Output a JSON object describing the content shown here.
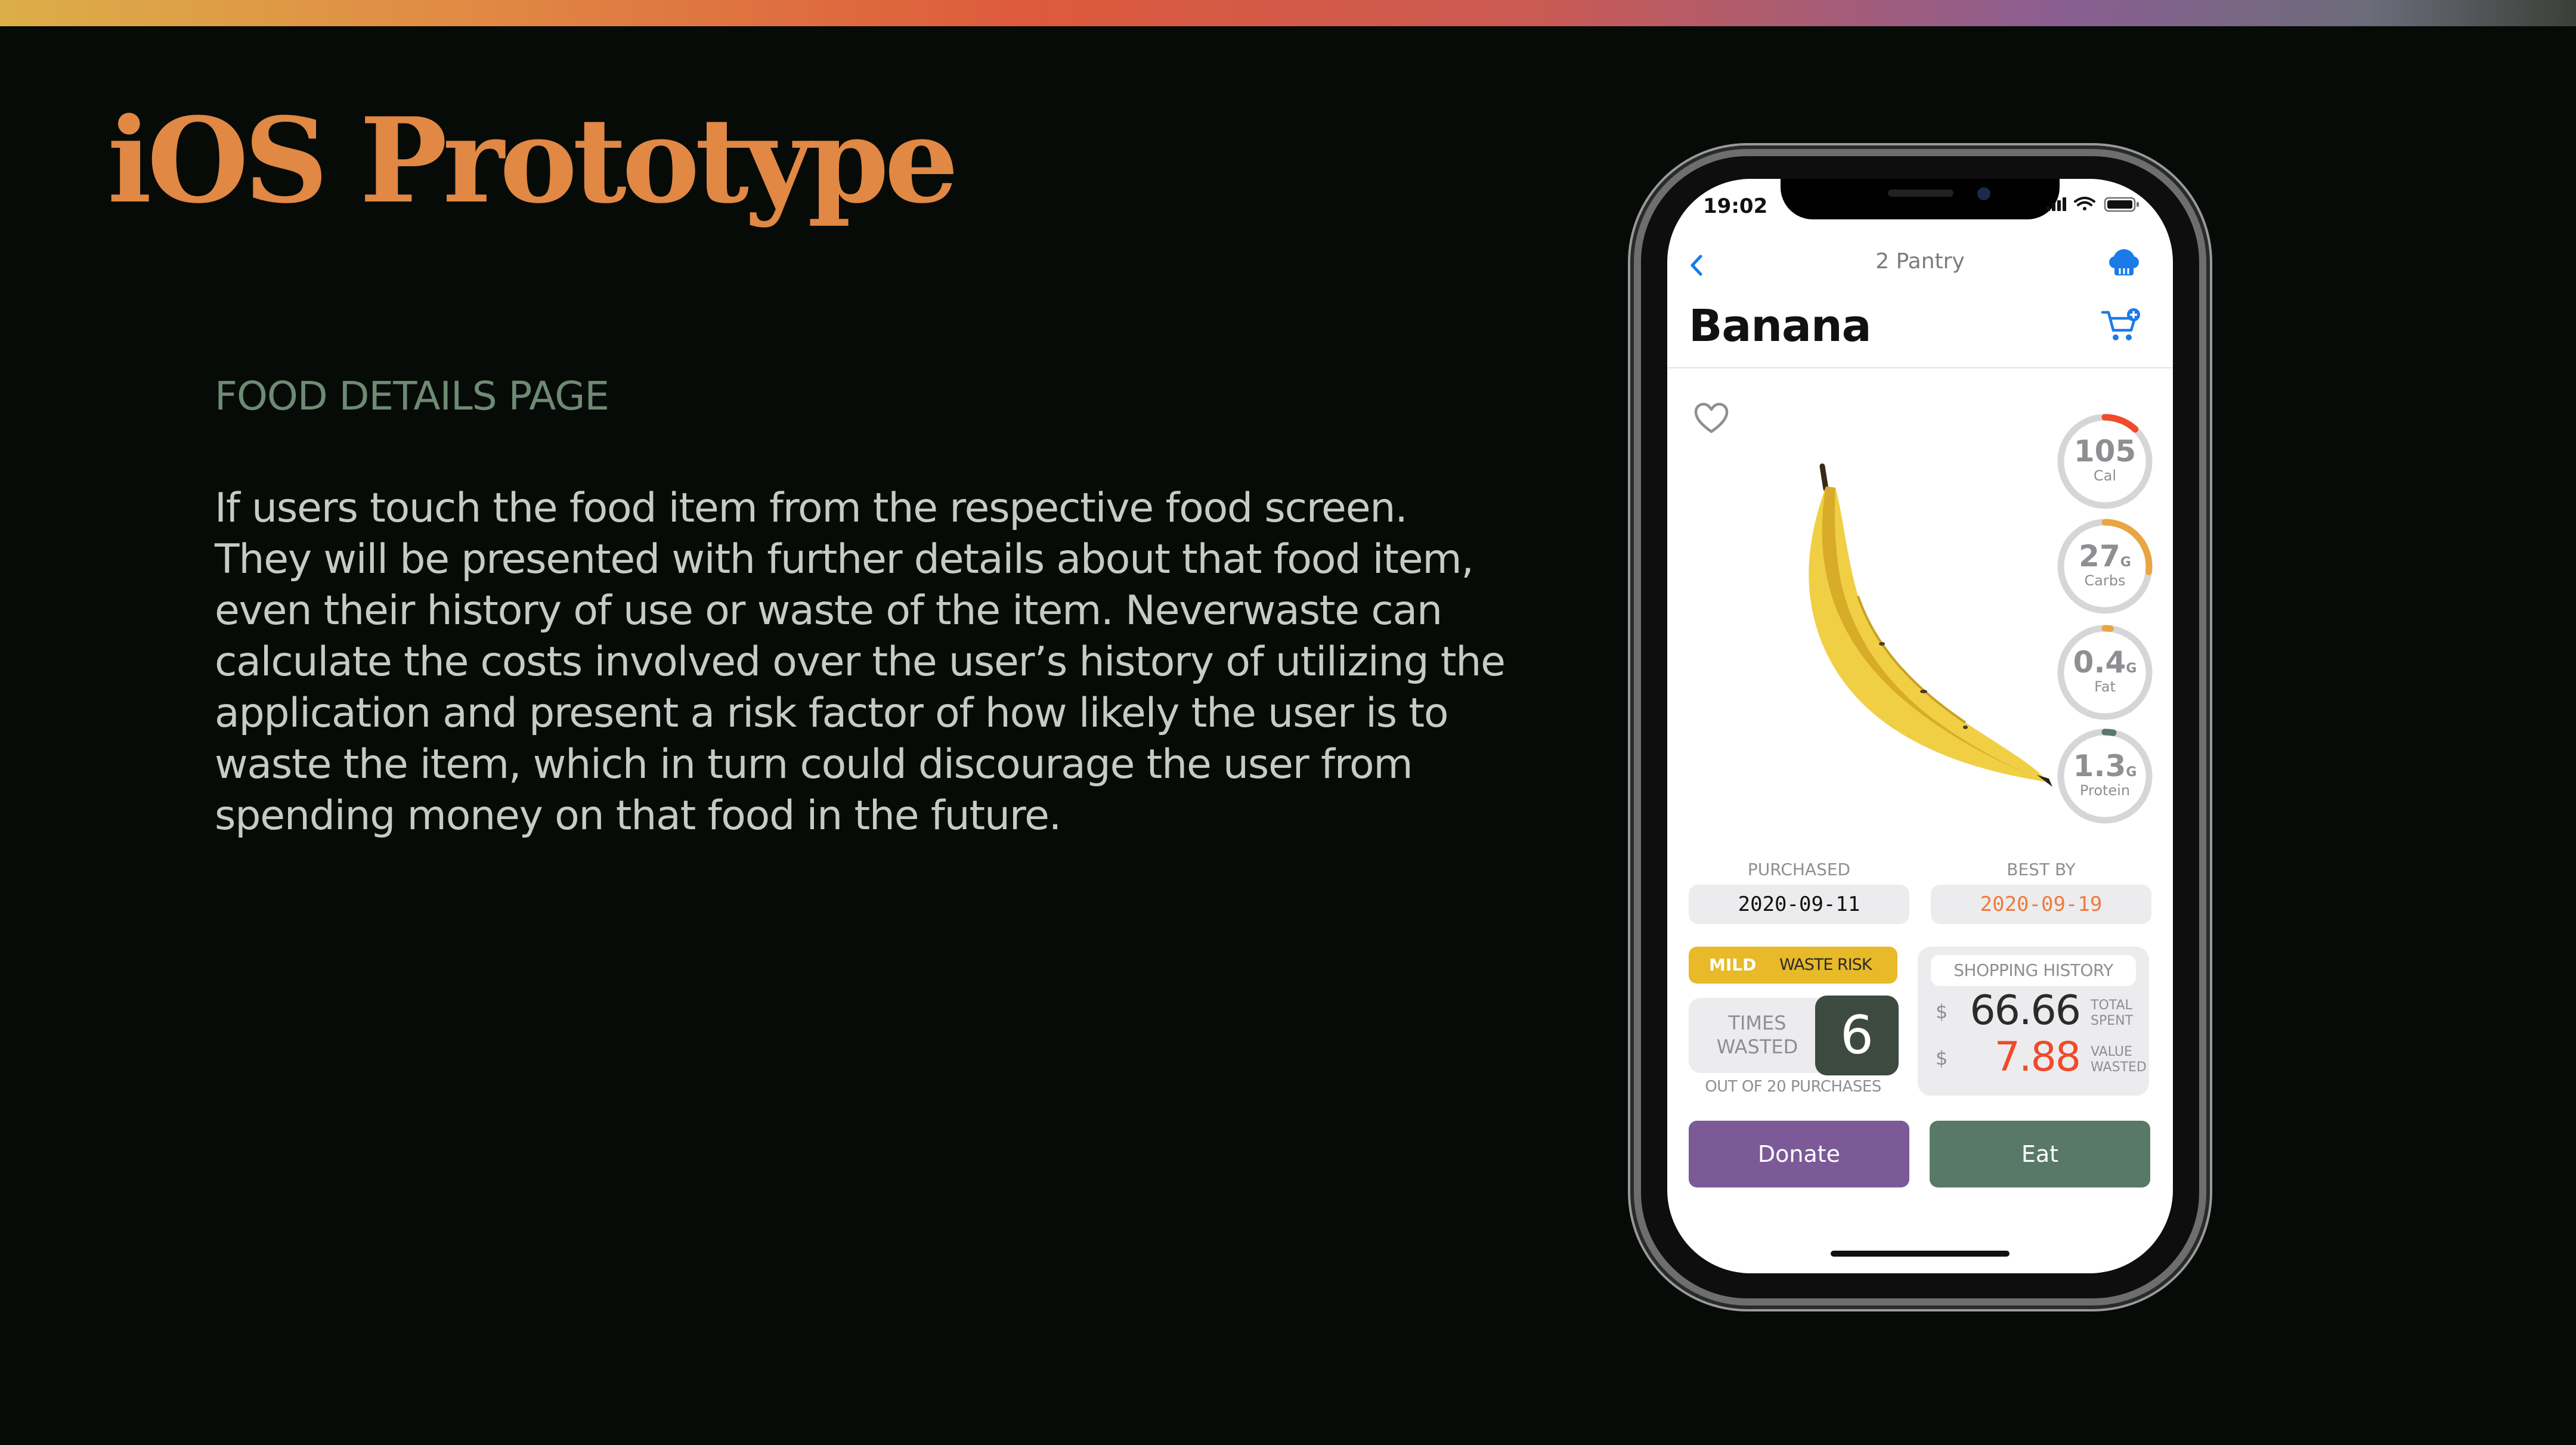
{
  "slide": {
    "title": "iOS Prototype",
    "section_heading": "FOOD DETAILS PAGE",
    "description": "If users touch the food item from the respective food screen. They will be presented with further details about that food item, even their history of use or waste of the item. Neverwaste can calculate the costs involved over the user’s history of utilizing the application and present a risk factor of how likely the user is to waste the item, which in turn could discourage the user from spending money on that food in the future."
  },
  "colors": {
    "title": "#e08844",
    "heading": "#6e8a74",
    "accent_blue": "#1a7be8",
    "ring_fill": "#e8a640",
    "ring_high": "#f04a2a",
    "ring_track": "#d6d6d9",
    "best_by": "#f07a3a",
    "waste_risk": "#e8b928",
    "value_wasted": "#f04a2a",
    "donate": "#7c5a98",
    "eat": "#587868"
  },
  "phone": {
    "status": {
      "time": "19:02",
      "icons": [
        "signal-icon",
        "wifi-icon",
        "battery-icon"
      ]
    },
    "nav": {
      "back_icon": "chevron-left-icon",
      "title": "2 Pantry",
      "chef_icon": "chef-hat-icon"
    },
    "page_title": "Banana",
    "cart_icon": "cart-add-icon",
    "favorite_icon": "heart-icon",
    "nutrition": [
      {
        "value": "105",
        "unit": "",
        "label": "Cal",
        "fill": 0.12
      },
      {
        "value": "27",
        "unit": "G",
        "label": "Carbs",
        "fill": 0.27
      },
      {
        "value": "0.4",
        "unit": "G",
        "label": "Fat",
        "fill": 0.02
      },
      {
        "value": "1.3",
        "unit": "G",
        "label": "Protein",
        "fill": 0.03
      }
    ],
    "purchased": {
      "label": "PURCHASED",
      "date": "2020-09-11"
    },
    "best_by": {
      "label": "BEST BY",
      "date": "2020-09-19"
    },
    "waste_risk": {
      "level": "MILD",
      "label": "WASTE RISK"
    },
    "times_wasted": {
      "label_line1": "TIMES",
      "label_line2": "WASTED",
      "count": "6",
      "out_of": "OUT OF 20 PURCHASES"
    },
    "shopping_history": {
      "title": "SHOPPING HISTORY",
      "currency": "$",
      "total_spent": "66.66",
      "total_label_line1": "TOTAL",
      "total_label_line2": "SPENT",
      "value_wasted": "7.88",
      "wasted_label_line1": "VALUE",
      "wasted_label_line2": "WASTED"
    },
    "buttons": {
      "donate": "Donate",
      "eat": "Eat"
    }
  }
}
